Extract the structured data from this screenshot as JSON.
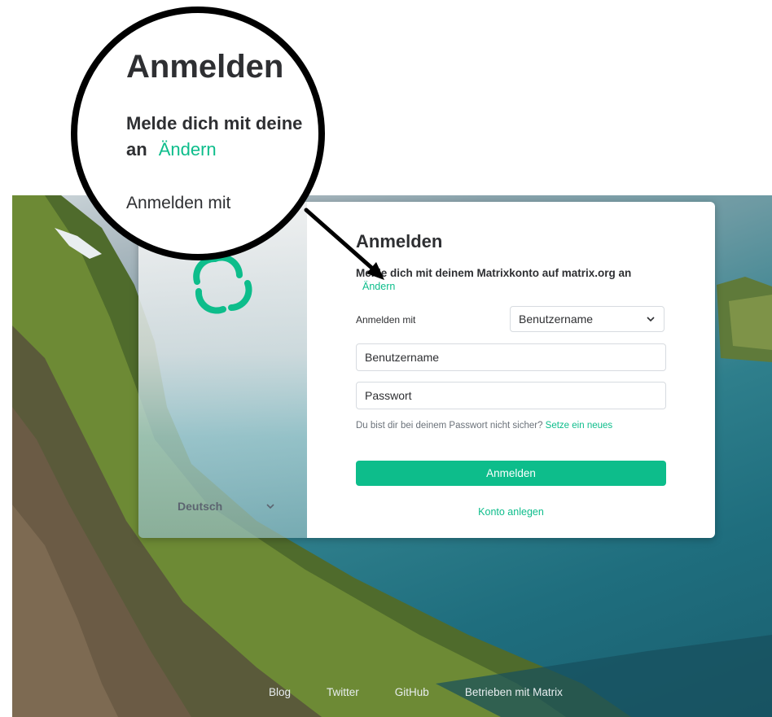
{
  "card": {
    "title": "Anmelden",
    "subtitle": "Melde dich mit deinem Matrixkonto auf matrix.org an",
    "change_link": "Ändern",
    "login_with_label": "Anmelden mit",
    "login_type_select": "Benutzername",
    "username_placeholder": "Benutzername",
    "password_placeholder": "Passwort",
    "forgot_text": "Du bist dir bei deinem Passwort nicht sicher?",
    "forgot_link": "Setze ein neues",
    "submit_label": "Anmelden",
    "create_account": "Konto anlegen"
  },
  "language": {
    "selected": "Deutsch"
  },
  "footer": {
    "links": [
      "Blog",
      "Twitter",
      "GitHub",
      "Betrieben mit Matrix"
    ]
  },
  "lens": {
    "title": "Anmelden",
    "subtitle_line1": "Melde dich mit deine",
    "subtitle_line2": "an",
    "change_link": "Ändern",
    "login_with_label": "Anmelden mit"
  },
  "colors": {
    "accent": "#0dbd8b",
    "text": "#2e2f32"
  },
  "icons": [
    "element-logo-icon",
    "chevron-down-icon"
  ]
}
